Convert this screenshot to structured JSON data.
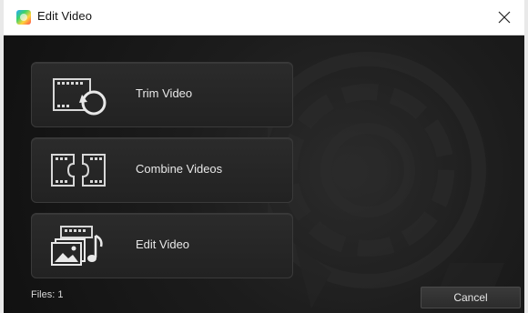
{
  "window": {
    "title": "Edit Video",
    "app_icon": "app-logo-icon",
    "close_icon": "close-icon"
  },
  "actions": [
    {
      "label": "Trim Video",
      "icon": "trim-video-icon"
    },
    {
      "label": "Combine Videos",
      "icon": "combine-videos-icon"
    },
    {
      "label": "Edit Video",
      "icon": "edit-video-icon"
    }
  ],
  "footer": {
    "files_label": "Files: 1",
    "cancel_label": "Cancel"
  },
  "colors": {
    "background": "#111111",
    "button": "#262626",
    "text": "#e8e8e8"
  }
}
